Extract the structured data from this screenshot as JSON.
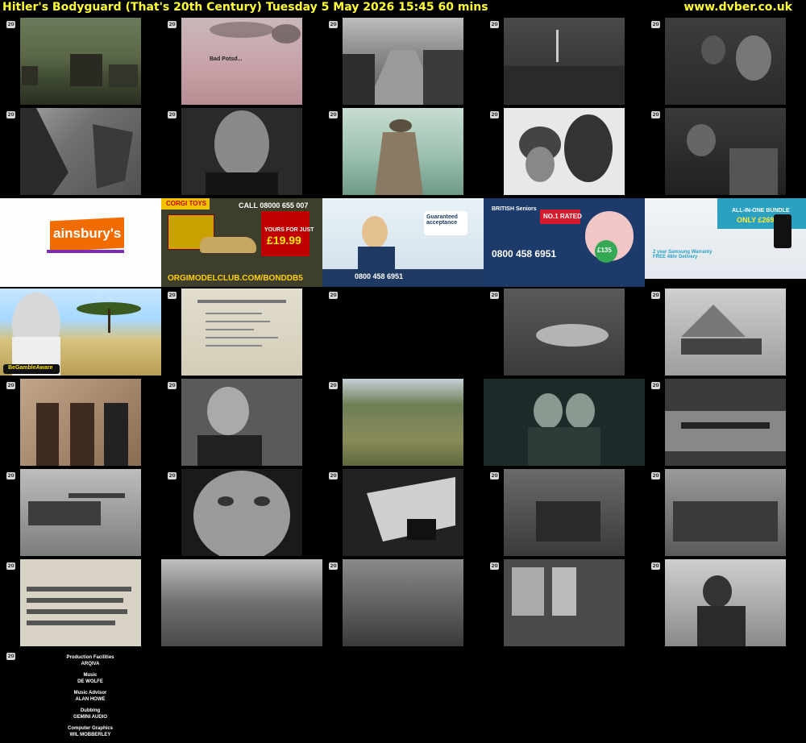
{
  "header": {
    "title": "Hitler's Bodyguard (That's 20th Century)    Tuesday 5 May 2026  15:45  60 mins",
    "site": "www.dvber.co.uk"
  },
  "channel_logo": "20",
  "ads": {
    "sainsburys": "ainsbury's",
    "corgi_call": "CALL 08000 655 007",
    "corgi_price": "£19.99",
    "corgi_url": "ORGIMODELCLUB.COM/BONDDB5",
    "corgi_brand": "CORGI TOYS",
    "corgi_yours": "YOURS FOR JUST",
    "bs_headline": "Guaranteed acceptance",
    "bs_phone": "0800 458 6951",
    "bs2_rated": "NO.1 RATED",
    "bs2_phone": "0800 458 6951",
    "bs2_price": "£135",
    "bs_brand": "BRITISH Seniors",
    "eas_bundle": "ALL-IN-ONE BUNDLE",
    "eas_price": "ONLY £269",
    "eas_warranty": "2 year Samsung Warranty FREE 48hr Delivery",
    "gamble": "BeGambleAware"
  },
  "thumb_captions": {
    "bad_potsdam": "Bad Potsd..."
  },
  "credits": [
    {
      "role": "Production Facilities",
      "name": "ARQIVA"
    },
    {
      "role": "Music",
      "name": "DE WOLFE"
    },
    {
      "role": "Music Advisor",
      "name": "ALAN HOWE"
    },
    {
      "role": "Dubbing",
      "name": "GEMINI AUDIO"
    },
    {
      "role": "Computer Graphics",
      "name": "WIL MOBBERLEY"
    }
  ]
}
